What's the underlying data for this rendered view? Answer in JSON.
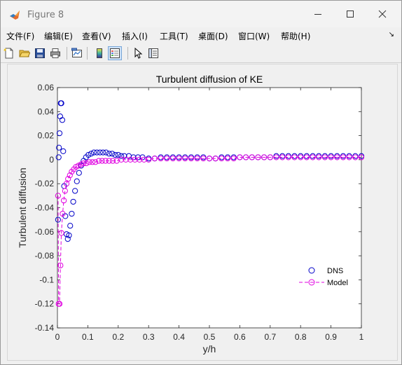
{
  "window": {
    "title": "Figure 8"
  },
  "menu": {
    "items": [
      "文件(F)",
      "编辑(E)",
      "查看(V)",
      "插入(I)",
      "工具(T)",
      "桌面(D)",
      "窗口(W)",
      "帮助(H)"
    ]
  },
  "toolbar": {
    "buttons": [
      "new-figure",
      "open-file",
      "save",
      "print",
      "link-plot",
      "colorbar",
      "legend",
      "pointer-arrow",
      "property-inspector"
    ]
  },
  "colors": {
    "dns": "#0000c8",
    "model": "#e000e0",
    "window_bg": "#f0f0f0"
  },
  "chart_data": {
    "type": "scatter",
    "title": "Turbulent diffusion of KE",
    "xlabel": "y/h",
    "ylabel": "Turbulent diffusion",
    "xlim": [
      0,
      1
    ],
    "ylim": [
      -0.14,
      0.06
    ],
    "xticks": [
      "0",
      "0.1",
      "0.2",
      "0.3",
      "0.4",
      "0.5",
      "0.6",
      "0.7",
      "0.8",
      "0.9",
      "1"
    ],
    "yticks": [
      "0.06",
      "0.04",
      "0.02",
      "0",
      "-0.02",
      "-0.04",
      "-0.06",
      "-0.08",
      "-0.1",
      "-0.12",
      "-0.14"
    ],
    "legend_position": "bottom-right",
    "grid": false,
    "series": [
      {
        "name": "DNS",
        "style": "markers",
        "color": "#0000c8",
        "points": [
          [
            0.002,
            -0.05
          ],
          [
            0.004,
            0.002
          ],
          [
            0.005,
            0.01
          ],
          [
            0.007,
            0.022
          ],
          [
            0.009,
            0.036
          ],
          [
            0.011,
            0.047
          ],
          [
            0.013,
            0.047
          ],
          [
            0.016,
            0.033
          ],
          [
            0.019,
            0.007
          ],
          [
            0.022,
            -0.022
          ],
          [
            0.026,
            -0.047
          ],
          [
            0.03,
            -0.062
          ],
          [
            0.034,
            -0.066
          ],
          [
            0.038,
            -0.063
          ],
          [
            0.042,
            -0.055
          ],
          [
            0.047,
            -0.045
          ],
          [
            0.052,
            -0.035
          ],
          [
            0.058,
            -0.026
          ],
          [
            0.064,
            -0.018
          ],
          [
            0.071,
            -0.011
          ],
          [
            0.078,
            -0.005
          ],
          [
            0.086,
            -0.001
          ],
          [
            0.094,
            0.002
          ],
          [
            0.102,
            0.004
          ],
          [
            0.111,
            0.005
          ],
          [
            0.12,
            0.006
          ],
          [
            0.13,
            0.006
          ],
          [
            0.14,
            0.006
          ],
          [
            0.15,
            0.006
          ],
          [
            0.16,
            0.006
          ],
          [
            0.17,
            0.005
          ],
          [
            0.18,
            0.005
          ],
          [
            0.19,
            0.004
          ],
          [
            0.2,
            0.004
          ],
          [
            0.21,
            0.003
          ],
          [
            0.22,
            0.003
          ],
          [
            0.235,
            0.003
          ],
          [
            0.25,
            0.002
          ],
          [
            0.265,
            0.002
          ],
          [
            0.28,
            0.002
          ],
          [
            0.3,
            0.001
          ],
          [
            0.32,
            0.001
          ],
          [
            0.34,
            0.002
          ],
          [
            0.36,
            0.002
          ],
          [
            0.38,
            0.002
          ],
          [
            0.4,
            0.002
          ],
          [
            0.42,
            0.002
          ],
          [
            0.44,
            0.002
          ],
          [
            0.46,
            0.002
          ],
          [
            0.48,
            0.002
          ],
          [
            0.5,
            0.001
          ],
          [
            0.52,
            0.001
          ],
          [
            0.54,
            0.002
          ],
          [
            0.56,
            0.002
          ],
          [
            0.58,
            0.002
          ],
          [
            0.6,
            0.002
          ],
          [
            0.62,
            0.002
          ],
          [
            0.64,
            0.002
          ],
          [
            0.66,
            0.002
          ],
          [
            0.68,
            0.002
          ],
          [
            0.7,
            0.002
          ],
          [
            0.72,
            0.003
          ],
          [
            0.74,
            0.003
          ],
          [
            0.76,
            0.003
          ],
          [
            0.78,
            0.003
          ],
          [
            0.8,
            0.003
          ],
          [
            0.82,
            0.003
          ],
          [
            0.84,
            0.003
          ],
          [
            0.86,
            0.003
          ],
          [
            0.88,
            0.003
          ],
          [
            0.9,
            0.003
          ],
          [
            0.92,
            0.003
          ],
          [
            0.94,
            0.003
          ],
          [
            0.96,
            0.003
          ],
          [
            0.98,
            0.003
          ],
          [
            1.0,
            0.003
          ]
        ]
      },
      {
        "name": "Model",
        "style": "dashed-line-markers",
        "color": "#e000e0",
        "points": [
          [
            0.002,
            -0.03
          ],
          [
            0.004,
            -0.12
          ],
          [
            0.007,
            -0.12
          ],
          [
            0.01,
            -0.088
          ],
          [
            0.013,
            -0.061
          ],
          [
            0.017,
            -0.045
          ],
          [
            0.021,
            -0.034
          ],
          [
            0.025,
            -0.026
          ],
          [
            0.03,
            -0.02
          ],
          [
            0.035,
            -0.016
          ],
          [
            0.041,
            -0.013
          ],
          [
            0.047,
            -0.01
          ],
          [
            0.054,
            -0.008
          ],
          [
            0.061,
            -0.006
          ],
          [
            0.069,
            -0.005
          ],
          [
            0.077,
            -0.004
          ],
          [
            0.086,
            -0.003
          ],
          [
            0.095,
            -0.003
          ],
          [
            0.105,
            -0.002
          ],
          [
            0.115,
            -0.002
          ],
          [
            0.125,
            -0.002
          ],
          [
            0.136,
            -0.001
          ],
          [
            0.147,
            -0.001
          ],
          [
            0.158,
            -0.001
          ],
          [
            0.17,
            -0.001
          ],
          [
            0.182,
            -0.001
          ],
          [
            0.195,
            -0.001
          ],
          [
            0.21,
            0.0
          ],
          [
            0.225,
            0.0
          ],
          [
            0.24,
            0.0
          ],
          [
            0.255,
            0.0
          ],
          [
            0.27,
            0.0
          ],
          [
            0.285,
            0.0
          ],
          [
            0.3,
            0.0
          ],
          [
            0.32,
            0.001
          ],
          [
            0.34,
            0.001
          ],
          [
            0.36,
            0.001
          ],
          [
            0.38,
            0.001
          ],
          [
            0.4,
            0.001
          ],
          [
            0.42,
            0.001
          ],
          [
            0.44,
            0.001
          ],
          [
            0.46,
            0.001
          ],
          [
            0.48,
            0.001
          ],
          [
            0.5,
            0.001
          ],
          [
            0.52,
            0.001
          ],
          [
            0.54,
            0.001
          ],
          [
            0.56,
            0.001
          ],
          [
            0.58,
            0.001
          ],
          [
            0.6,
            0.002
          ],
          [
            0.62,
            0.002
          ],
          [
            0.64,
            0.002
          ],
          [
            0.66,
            0.002
          ],
          [
            0.68,
            0.002
          ],
          [
            0.7,
            0.002
          ],
          [
            0.72,
            0.002
          ],
          [
            0.74,
            0.002
          ],
          [
            0.76,
            0.002
          ],
          [
            0.78,
            0.002
          ],
          [
            0.8,
            0.002
          ],
          [
            0.82,
            0.002
          ],
          [
            0.84,
            0.002
          ],
          [
            0.86,
            0.002
          ],
          [
            0.88,
            0.002
          ],
          [
            0.9,
            0.002
          ],
          [
            0.92,
            0.002
          ],
          [
            0.94,
            0.002
          ],
          [
            0.96,
            0.002
          ],
          [
            0.98,
            0.002
          ],
          [
            1.0,
            0.002
          ]
        ]
      }
    ]
  }
}
